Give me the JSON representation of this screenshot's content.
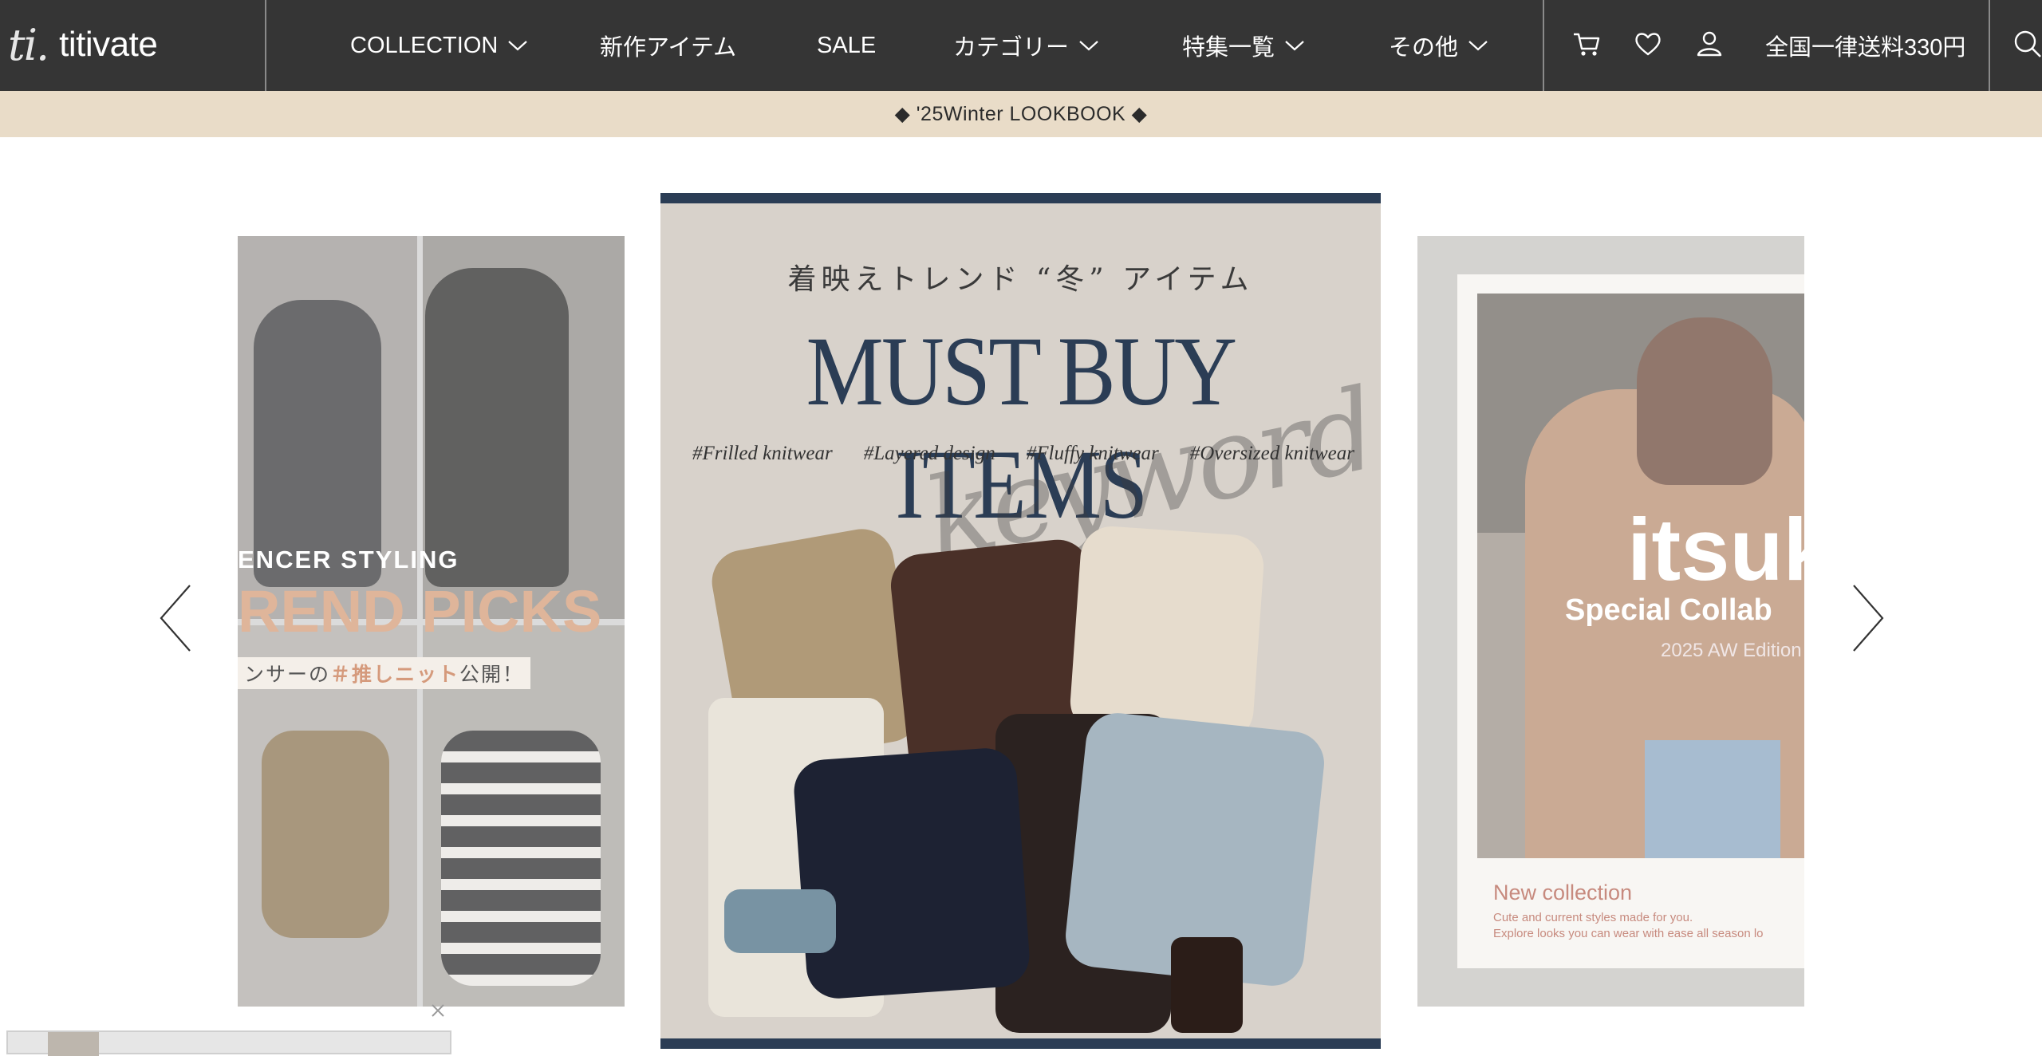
{
  "header": {
    "logo_mark": "ti.",
    "logo_text": "titivate",
    "nav": [
      {
        "label": "COLLECTION",
        "has_dropdown": true
      },
      {
        "label": "新作アイテム",
        "has_dropdown": false
      },
      {
        "label": "SALE",
        "has_dropdown": false
      },
      {
        "label": "カテゴリー",
        "has_dropdown": true
      },
      {
        "label": "特集一覧",
        "has_dropdown": true
      },
      {
        "label": "その他",
        "has_dropdown": true
      }
    ],
    "icons": [
      "cart-icon",
      "heart-icon",
      "user-icon",
      "search-icon"
    ],
    "shipping": "全国一律送料330円",
    "bg_color": "#353535"
  },
  "announcement": {
    "text": "◆ '25Winter LOOKBOOK ◆",
    "bg_color": "#e9dcc8"
  },
  "carousel": {
    "left_slide": {
      "line1": "ENCER STYLING",
      "line2": "REND PICKS",
      "line3_prefix": "ンサーの",
      "line3_accent": "＃推しニット",
      "line3_suffix": "公開！"
    },
    "center_slide": {
      "subtitle": "着映えトレンド “冬” アイテム",
      "title": "MUST BUY ITEMS",
      "script": "keyword",
      "tags": [
        "#Frilled knitwear",
        "#Layered design",
        "#Fluffy knitwear",
        "#Oversized knitwear"
      ],
      "accent_color": "#2b3d55"
    },
    "right_slide": {
      "name": "itsuk",
      "collab": "Special Collab",
      "edition": "2025 AW Edition",
      "new_collection": "New collection",
      "desc_line1": "Cute and current styles made for you.",
      "desc_line2": "Explore looks you can wear with ease all season lo"
    }
  },
  "widget": {
    "close": "×"
  }
}
